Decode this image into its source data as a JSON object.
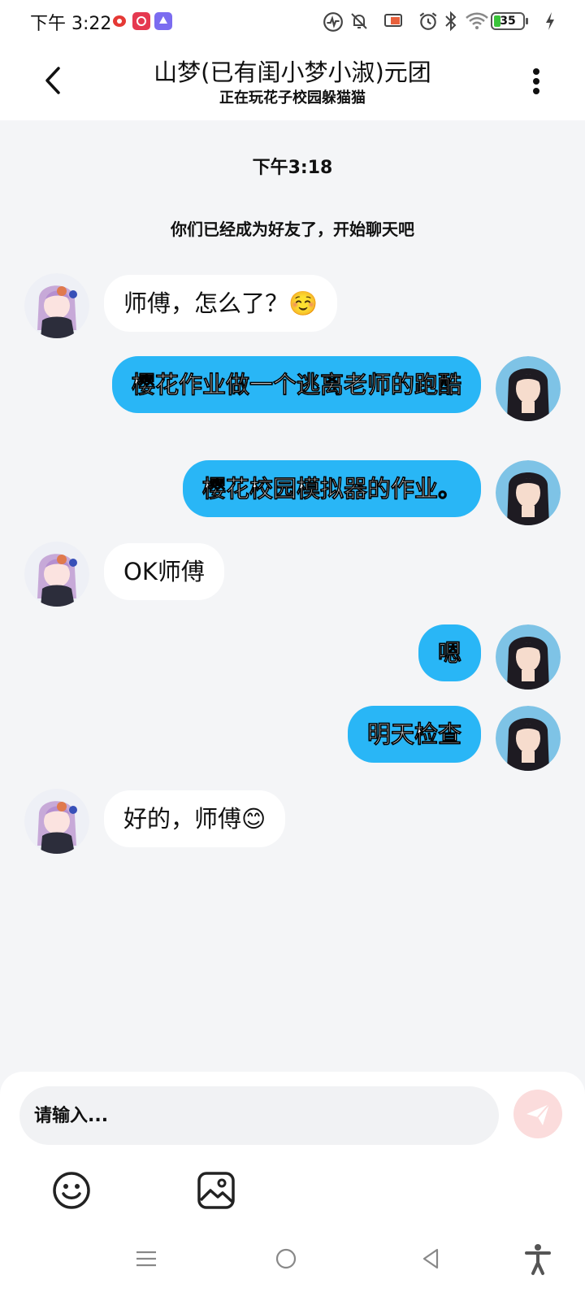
{
  "status_bar": {
    "time": "下午 3:22",
    "battery": "35"
  },
  "header": {
    "title": "山梦(已有闺小梦小淑)元团",
    "subtitle": "正在玩花子校园躲猫猫"
  },
  "chat": {
    "time_stamp": "下午3:18",
    "system_message": "你们已经成为好友了，开始聊天吧",
    "messages": [
      {
        "side": "left",
        "text": "师傅，怎么了？☺️"
      },
      {
        "side": "right",
        "text": "樱花作业做一个逃离老师的跑酷"
      },
      {
        "side": "right",
        "text": "樱花校园模拟器的作业。"
      },
      {
        "side": "left",
        "text": "OK师傅"
      },
      {
        "side": "right",
        "text": "嗯"
      },
      {
        "side": "right",
        "text": "明天检查"
      },
      {
        "side": "left",
        "text": "好的，师傅😊"
      }
    ]
  },
  "input": {
    "placeholder": "请输入..."
  },
  "icons": {
    "back": "back-arrow-icon",
    "more": "more-vertical-icon",
    "send": "send-icon",
    "emoji": "emoji-icon",
    "image": "image-icon"
  },
  "colors": {
    "bubble_right": "#29b6f6",
    "bubble_left": "#ffffff",
    "background": "#f4f5f7",
    "send_button": "#fbdcdc"
  }
}
